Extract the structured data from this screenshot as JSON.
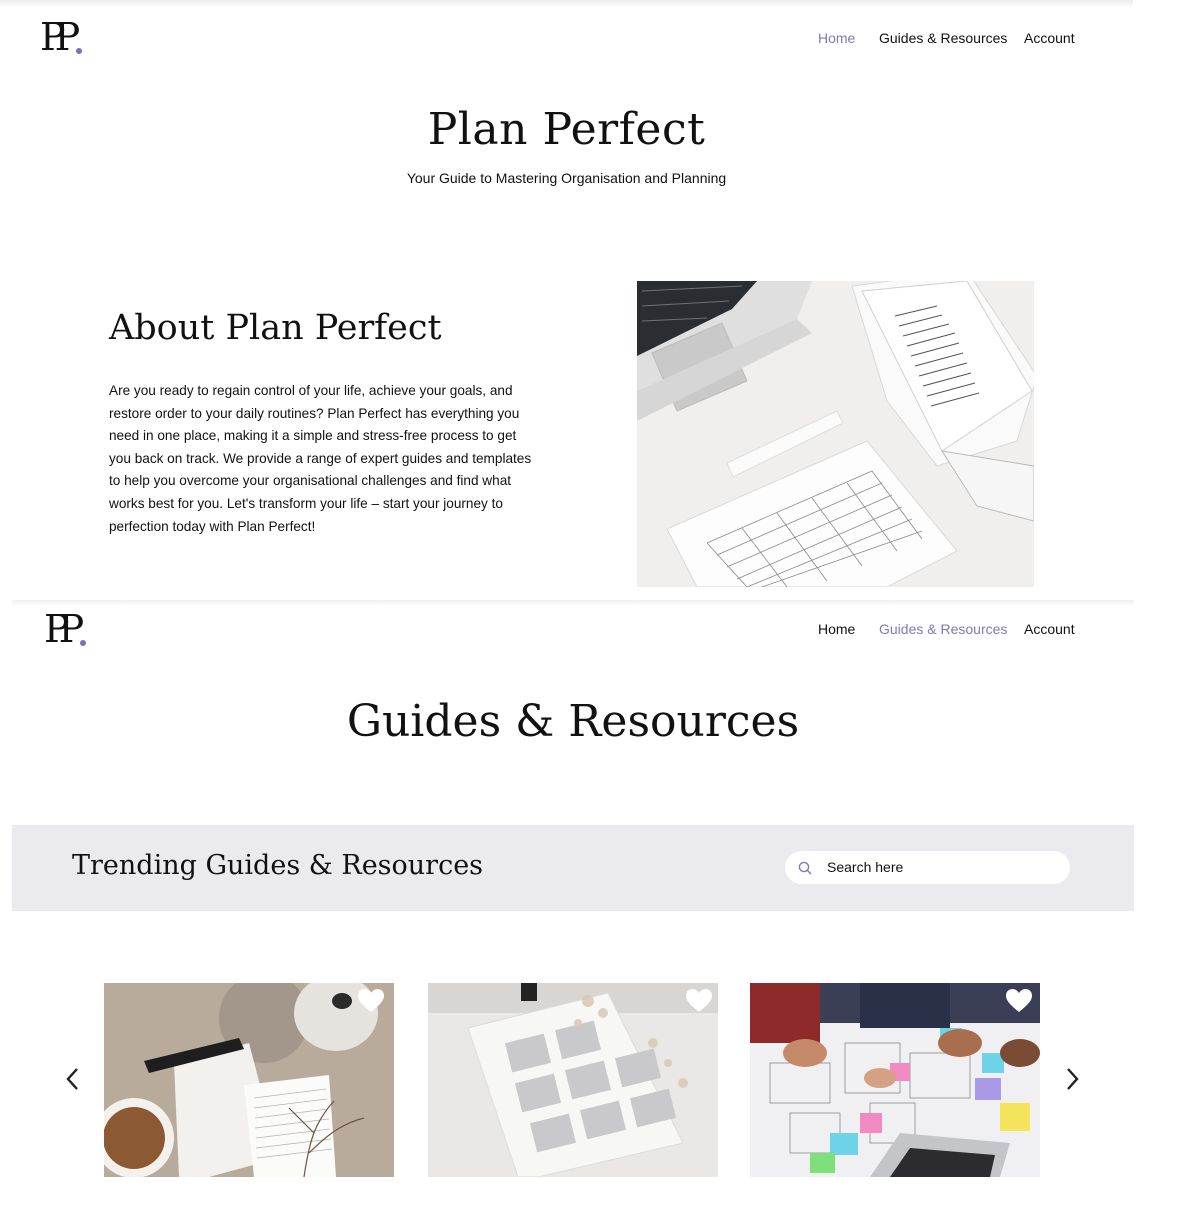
{
  "brand": {
    "logo_text": "PP",
    "accent_color": "#7f79b9"
  },
  "home": {
    "nav": [
      {
        "label": "Home",
        "active": true
      },
      {
        "label": "Guides & Resources",
        "active": false
      },
      {
        "label": "Account",
        "active": false
      }
    ],
    "hero_title": "Plan Perfect",
    "hero_subtitle": "Your Guide to Mastering Organisation and Planning",
    "about_title": "About Plan Perfect",
    "about_body": "Are you ready to regain control of your life, achieve your goals, and restore order to your daily routines? Plan Perfect has everything you need in one place, making it a simple and stress-free process to get you back on track. We provide a range of expert guides and templates to help you overcome your organisational challenges and find what works best for you. Let's transform your life – start your journey to perfection today with Plan Perfect!",
    "about_image": "laptop-and-planner-photo"
  },
  "guides": {
    "nav": [
      {
        "label": "Home",
        "active": false
      },
      {
        "label": "Guides & Resources",
        "active": true
      },
      {
        "label": "Account",
        "active": false
      }
    ],
    "page_title": "Guides & Resources",
    "trending_title": "Trending Guides & Resources",
    "search_placeholder": "Search here",
    "cards": [
      {
        "image": "coffee-and-checklist-photo",
        "icon": "heart-icon"
      },
      {
        "image": "calendar-planner-photo",
        "icon": "heart-icon"
      },
      {
        "image": "team-sticky-notes-photo",
        "icon": "heart-icon"
      }
    ],
    "prev_icon": "chevron-left-icon",
    "next_icon": "chevron-right-icon",
    "band_color": "#ebeaef"
  }
}
